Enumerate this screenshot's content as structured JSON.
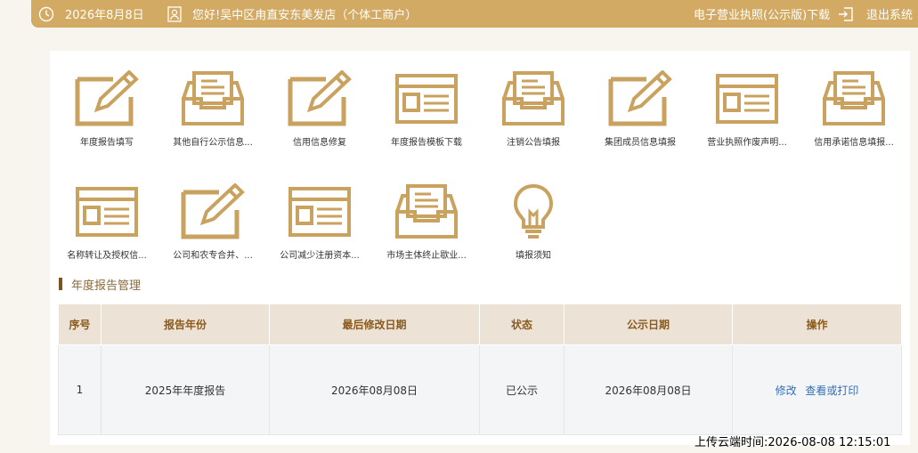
{
  "topbar": {
    "date": "2026年8月8日",
    "greeting": "您好!吴中区甪直安东美发店（个体工商户）",
    "license_download": "电子营业执照(公示版)下载",
    "logout": "退出系统",
    "bg_color": "#d2aa63"
  },
  "tiles": [
    {
      "label": "年度报告填写",
      "icon": "pencil-form-icon"
    },
    {
      "label": "其他自行公示信息...",
      "icon": "inbox-tray-icon"
    },
    {
      "label": "信用信息修复",
      "icon": "pencil-form-icon"
    },
    {
      "label": "年度报告模板下载",
      "icon": "window-form-icon"
    },
    {
      "label": "注销公告填报",
      "icon": "inbox-tray-icon"
    },
    {
      "label": "集团成员信息填报",
      "icon": "pencil-form-icon"
    },
    {
      "label": "营业执照作废声明...",
      "icon": "window-form-icon"
    },
    {
      "label": "信用承诺信息填报...",
      "icon": "inbox-tray-icon"
    },
    {
      "label": "名称转让及授权信...",
      "icon": "window-form-icon"
    },
    {
      "label": "公司和农专合并、...",
      "icon": "pencil-form-icon"
    },
    {
      "label": "公司减少注册资本...",
      "icon": "window-form-icon"
    },
    {
      "label": "市场主体终止歇业...",
      "icon": "inbox-tray-icon"
    },
    {
      "label": "填报须知",
      "icon": "lightbulb-icon"
    }
  ],
  "section": {
    "title": "年度报告管理"
  },
  "table": {
    "headers": [
      "序号",
      "报告年份",
      "最后修改日期",
      "状态",
      "公示日期",
      "操作"
    ],
    "rows": [
      {
        "no": "1",
        "year": "2025年年度报告",
        "modified": "2026年08月08日",
        "status": "已公示",
        "published": "2026年08月08日",
        "edit": "修改",
        "view": "查看或打印"
      }
    ]
  },
  "upload_stamp": "上传云端时间:2026-08-08 12:15:01",
  "accent_color": "#d2aa63",
  "link_color": "#2f6fb7"
}
